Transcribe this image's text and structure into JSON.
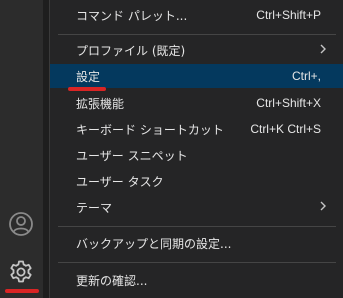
{
  "menu": {
    "items": [
      {
        "label": "コマンド パレット...",
        "shortcut": "Ctrl+Shift+P"
      },
      {
        "label": "プロファイル (既定)",
        "shortcut": "",
        "submenu": true
      },
      {
        "label": "設定",
        "shortcut": "Ctrl+,",
        "selected": true
      },
      {
        "label": "拡張機能",
        "shortcut": "Ctrl+Shift+X"
      },
      {
        "label": "キーボード ショートカット",
        "shortcut": "Ctrl+K Ctrl+S"
      },
      {
        "label": "ユーザー スニペット",
        "shortcut": ""
      },
      {
        "label": "ユーザー タスク",
        "shortcut": ""
      },
      {
        "label": "テーマ",
        "shortcut": "",
        "submenu": true
      },
      {
        "label": "バックアップと同期の設定...",
        "shortcut": ""
      },
      {
        "label": "更新の確認...",
        "shortcut": ""
      }
    ]
  },
  "activity_bar": {
    "icons": [
      "accounts-icon",
      "manage-gear-icon"
    ]
  },
  "colors": {
    "activity_bar_bg": "#2c2c2c",
    "menu_bg": "#252526",
    "selected_bg": "#04395e",
    "highlight_underline": "#d92525",
    "text": "#e6e6e6"
  }
}
